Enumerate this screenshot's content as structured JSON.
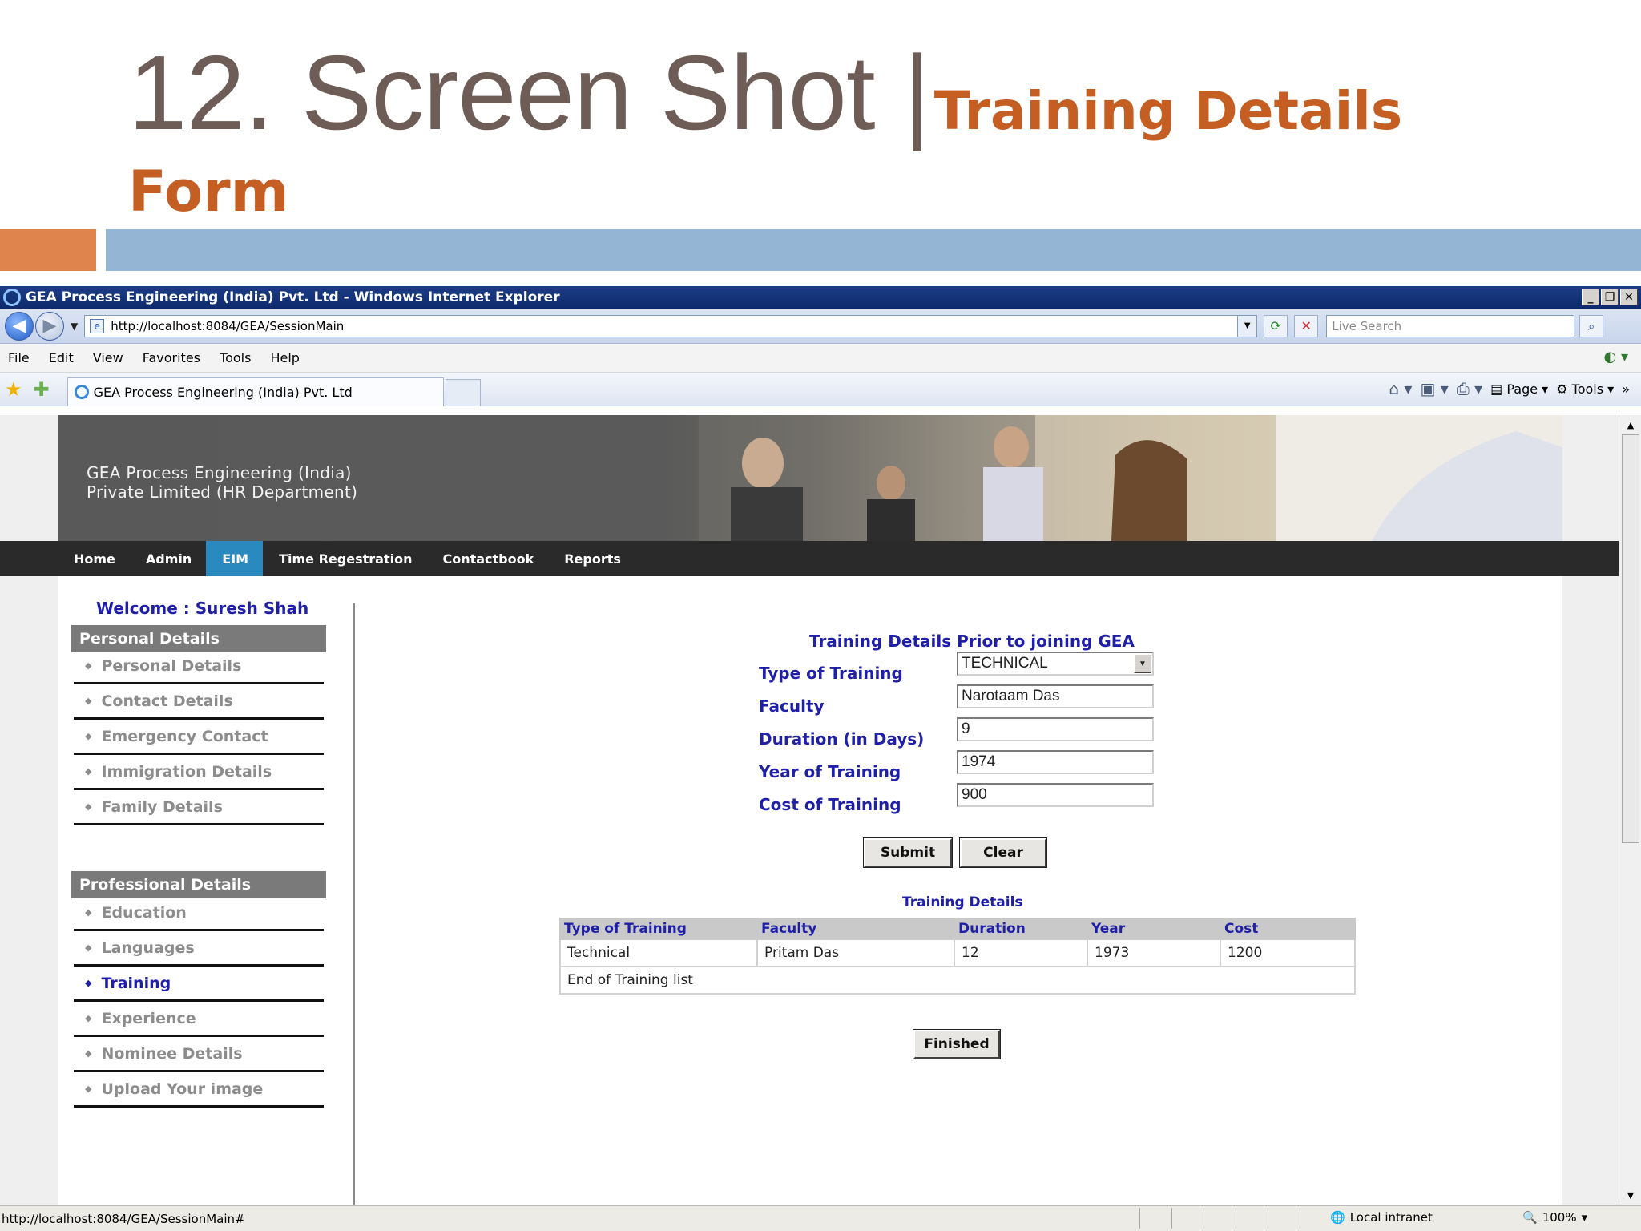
{
  "slide": {
    "title_main": "12. Screen Shot |",
    "title_sub": "Training Details",
    "title_line2": "Form"
  },
  "browser": {
    "window_title": "GEA Process Engineering (India) Pvt. Ltd - Windows Internet Explorer",
    "url": "http://localhost:8084/GEA/SessionMain",
    "search_placeholder": "Live Search",
    "menu": [
      "File",
      "Edit",
      "View",
      "Favorites",
      "Tools",
      "Help"
    ],
    "tab_title": "GEA Process Engineering (India) Pvt. Ltd",
    "cmd_page": "Page",
    "cmd_tools": "Tools",
    "status_url": "http://localhost:8084/GEA/SessionMain#",
    "status_zone": "Local intranet",
    "status_zoom": "100%"
  },
  "site": {
    "company_line1": "GEA Process Engineering (India)",
    "company_line2": "Private Limited (HR Department)",
    "nav": [
      "Home",
      "Admin",
      "EIM",
      "Time Regestration",
      "Contactbook",
      "Reports"
    ],
    "nav_active": "EIM",
    "welcome": "Welcome : Suresh Shah"
  },
  "sidebar": {
    "personal_heading": "Personal Details",
    "personal_items": [
      "Personal Details",
      "Contact Details",
      "Emergency Contact",
      "Immigration Details",
      "Family Details"
    ],
    "professional_heading": "Professional Details",
    "professional_items": [
      "Education",
      "Languages",
      "Training",
      "Experience",
      "Nominee Details",
      "Upload Your image"
    ],
    "current_item": "Training"
  },
  "form": {
    "title": "Training Details Prior to joining GEA",
    "type_label": "Type of Training",
    "type_value": "TECHNICAL",
    "faculty_label": "Faculty",
    "faculty_value": "Narotaam Das",
    "duration_label": "Duration (in Days)",
    "duration_value": "9",
    "year_label": "Year of Training",
    "year_value": "1974",
    "cost_label": "Cost of Training",
    "cost_value": "900",
    "submit_label": "Submit",
    "clear_label": "Clear"
  },
  "table": {
    "title": "Training Details",
    "headers": [
      "Type of Training",
      "Faculty",
      "Duration",
      "Year",
      "Cost"
    ],
    "rows": [
      [
        "Technical",
        "Pritam Das",
        "12",
        "1973",
        "1200"
      ]
    ],
    "end_text": "End of Training list",
    "finished_label": "Finished"
  },
  "colors": {
    "slide_title": "#6e5d56",
    "slide_accent": "#c55e23",
    "link_blue": "#1f1fa8",
    "nav_active": "#2a8abf"
  }
}
